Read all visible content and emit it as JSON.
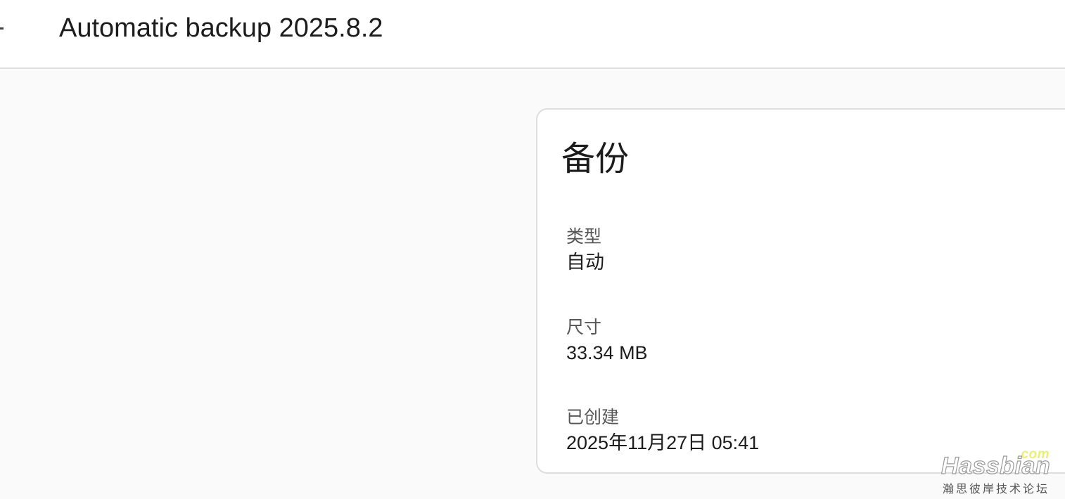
{
  "header": {
    "title": "Automatic backup 2025.8.2",
    "back_icon": "back-arrow-icon"
  },
  "card": {
    "title": "备份",
    "fields": [
      {
        "label": "类型",
        "value": "自动"
      },
      {
        "label": "尺寸",
        "value": "33.34 MB"
      },
      {
        "label": "已创建",
        "value": "2025年11月27日 05:41"
      }
    ]
  },
  "watermark": {
    "com": ".com",
    "brand": "Hassbian",
    "subtitle": "瀚思彼岸技术论坛"
  },
  "colors": {
    "background": "#fafafa",
    "surface": "#ffffff",
    "border": "#dedede",
    "text_primary": "#1c1c1c",
    "text_secondary": "#555555",
    "watermark_accent": "#e9ef7a"
  }
}
